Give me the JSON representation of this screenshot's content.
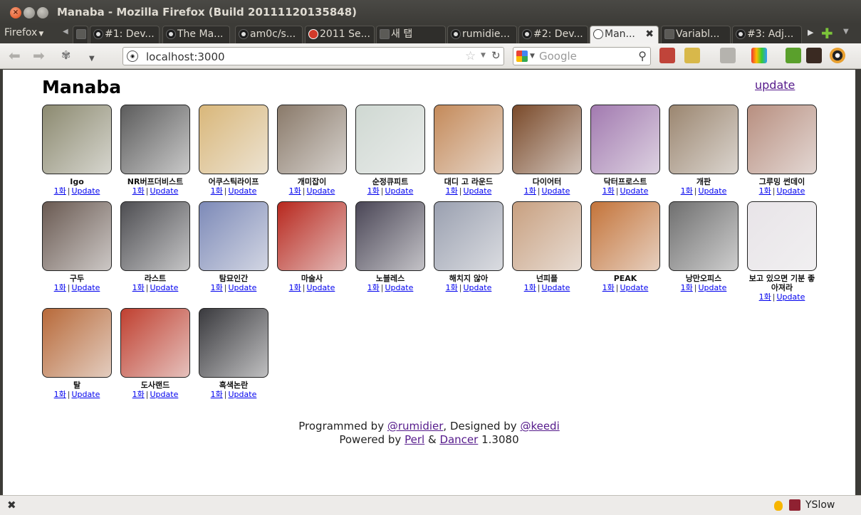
{
  "window": {
    "title": "Manaba - Mozilla Firefox (Build 20111120135848)"
  },
  "browser": {
    "menu_label": "Firefox",
    "tabs": [
      {
        "label": ".",
        "icon": "blank",
        "active": false
      },
      {
        "label": "#1: Dev...",
        "icon": "github",
        "active": false
      },
      {
        "label": "The Ma...",
        "icon": "github",
        "active": false
      },
      {
        "label": "am0c/s...",
        "icon": "github",
        "active": false
      },
      {
        "label": "2011 Se...",
        "icon": "red",
        "active": false
      },
      {
        "label": "새 탭",
        "icon": "blank",
        "active": false
      },
      {
        "label": "rumidie...",
        "icon": "github",
        "active": false
      },
      {
        "label": "#2: Dev...",
        "icon": "github",
        "active": false
      },
      {
        "label": "Man...",
        "icon": "site",
        "active": true
      },
      {
        "label": "Variabl...",
        "icon": "blank",
        "active": false
      },
      {
        "label": "#3: Adj...",
        "icon": "github",
        "active": false
      }
    ],
    "url": "localhost:3000",
    "search_placeholder": "Google"
  },
  "page": {
    "title": "Manaba",
    "update_link": "update",
    "episode_label": "1화",
    "separator": "|",
    "update_label": "Update",
    "comics": [
      {
        "title": "Igo",
        "color": "#8c8a70"
      },
      {
        "title": "NR버프더비스트",
        "color": "#5c5c5c"
      },
      {
        "title": "어쿠스틱라이프",
        "color": "#d9b77a"
      },
      {
        "title": "개미잡이",
        "color": "#8a7a6a"
      },
      {
        "title": "순정큐피트",
        "color": "#cfd8d2"
      },
      {
        "title": "대디 고 라운드",
        "color": "#c48a5a"
      },
      {
        "title": "다이어터",
        "color": "#7a4a2a"
      },
      {
        "title": "닥터프로스트",
        "color": "#a27ab0"
      },
      {
        "title": "개판",
        "color": "#9b8670"
      },
      {
        "title": "그루밍 썬데이",
        "color": "#b88f80"
      },
      {
        "title": "구두",
        "color": "#6a5a52"
      },
      {
        "title": "라스트",
        "color": "#4e4e52"
      },
      {
        "title": "탐묘인간",
        "color": "#7d8ab8"
      },
      {
        "title": "마술사",
        "color": "#b8281e"
      },
      {
        "title": "노블레스",
        "color": "#4a4656"
      },
      {
        "title": "해치지 않아",
        "color": "#9aa0b0"
      },
      {
        "title": "넌피플",
        "color": "#c8a080"
      },
      {
        "title": "PEAK",
        "color": "#c4743a"
      },
      {
        "title": "낭만오피스",
        "color": "#6f6f6f"
      },
      {
        "title": "보고 있으면 기분 좋아져라",
        "color": "#e8e4e8"
      },
      {
        "title": "탈",
        "color": "#b86a3a"
      },
      {
        "title": "도사랜드",
        "color": "#c04030"
      },
      {
        "title": "흑색논란",
        "color": "#3a3a3e"
      }
    ],
    "footer": {
      "programmed_by": "Programmed by",
      "programmer": "@rumidier",
      "designed_by": ", Designed by",
      "designer": "@keedi",
      "powered_by": "Powered by",
      "perl": "Perl",
      "amp": "&",
      "dancer": "Dancer",
      "version": "1.3080"
    }
  },
  "status": {
    "yslow": "YSlow"
  }
}
